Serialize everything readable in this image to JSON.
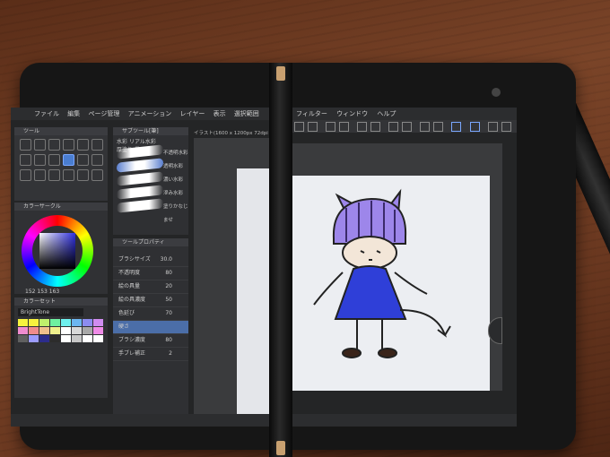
{
  "menu": [
    "ファイル",
    "編集",
    "ページ管理",
    "アニメーション",
    "レイヤー",
    "表示",
    "選択範囲"
  ],
  "menu_right": [
    "フィルター",
    "ウィンドウ",
    "ヘルプ"
  ],
  "panels": {
    "tool": "ツール",
    "subtool": "サブツール[筆]",
    "subtool_tabs": [
      "水彩",
      "リアル水彩",
      "厚塗り",
      "墨"
    ],
    "brushes": [
      "不透明水彩",
      "透明水彩",
      "濃い水彩",
      "滲み水彩",
      "塗りかなじませ"
    ],
    "color_circle": "カラーサークル",
    "color_set": "カラーセット",
    "brighttone": "BrightTone",
    "rgb": [
      "152",
      "153",
      "163"
    ],
    "tool_property": "ツールプロパティ",
    "properties": [
      {
        "label": "ブラシサイズ",
        "value": "30.0"
      },
      {
        "label": "不透明度",
        "value": "80"
      },
      {
        "label": "絵の具量",
        "value": "20"
      },
      {
        "label": "絵の具濃度",
        "value": "50"
      },
      {
        "label": "色延び",
        "value": "70"
      },
      {
        "label": "硬さ",
        "value": ""
      },
      {
        "label": "ブラシ濃度",
        "value": "80"
      },
      {
        "label": "手ブレ補正",
        "value": "2"
      }
    ],
    "canvas_title": "イラスト(1600 x 1200px 72dpi"
  },
  "colors": {
    "accent": "#4a7dd0",
    "dress": "#2f3fd8",
    "hair": "#9d86ea",
    "paper": "#eceef2"
  },
  "swatches": [
    "#f6f23e",
    "#f6f23e",
    "#bff06c",
    "#6ef0a0",
    "#6ef0ee",
    "#6cb6f0",
    "#8c8cf0",
    "#d08cf0",
    "#f08cd0",
    "#f08c8c",
    "#f0c08c",
    "#f0f08c",
    "#ffffff",
    "#d8d8d8",
    "#a8a8a8",
    "#f08ce8",
    "#606060",
    "#9c9cff",
    "#2c2c8c",
    "#2c2c2c",
    "#ffffff",
    "#c8c8c8",
    "#ffffff",
    "#ffffff"
  ]
}
